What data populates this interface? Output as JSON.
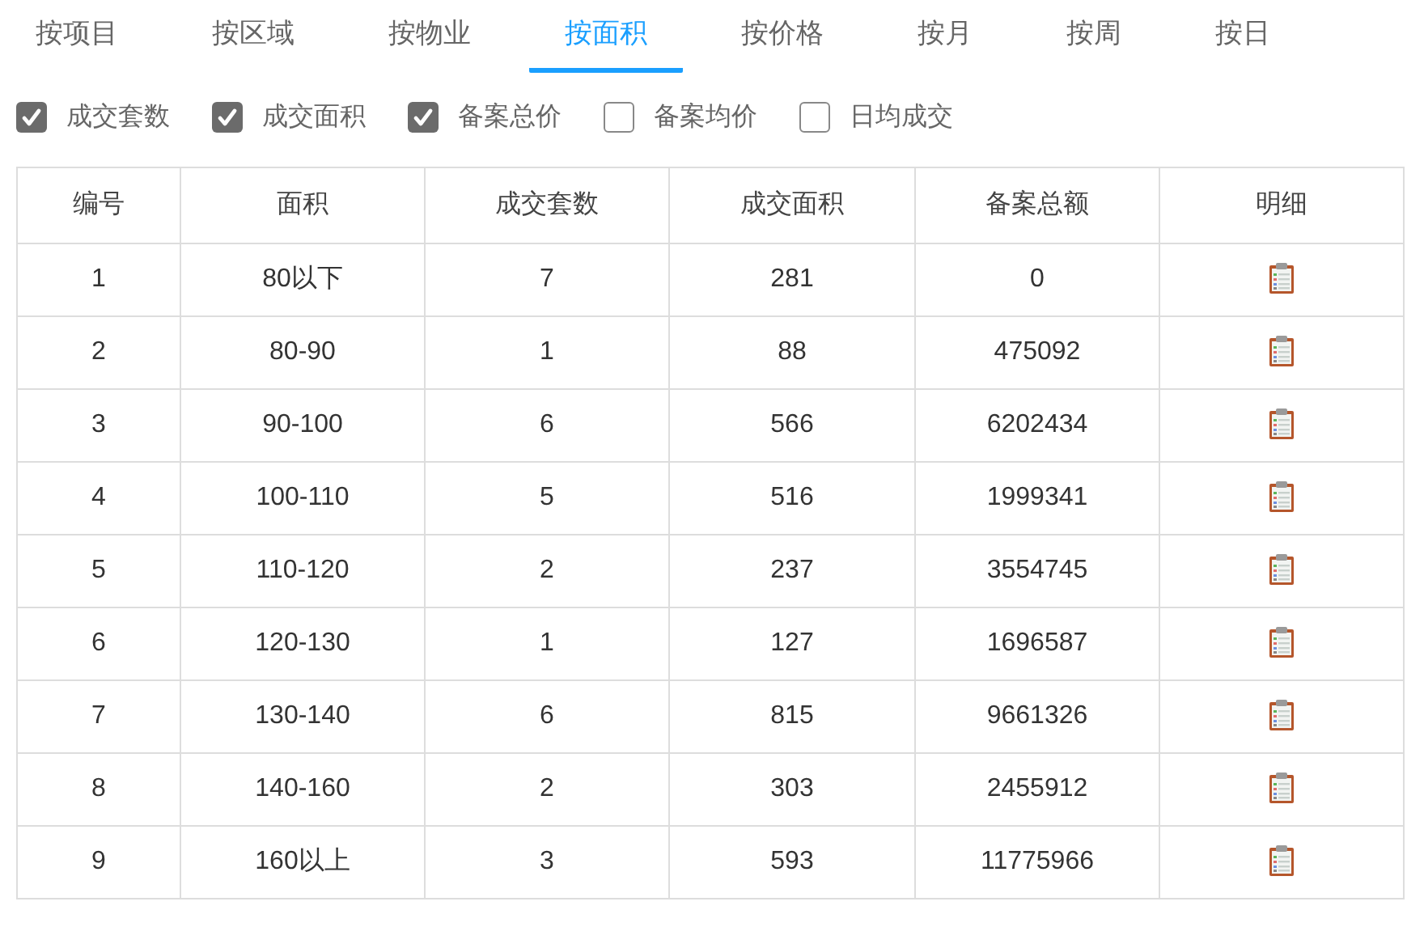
{
  "tabs": [
    {
      "label": "按项目",
      "selected": false
    },
    {
      "label": "按区域",
      "selected": false
    },
    {
      "label": "按物业",
      "selected": false
    },
    {
      "label": "按面积",
      "selected": true
    },
    {
      "label": "按价格",
      "selected": false
    },
    {
      "label": "按月",
      "selected": false
    },
    {
      "label": "按周",
      "selected": false
    },
    {
      "label": "按日",
      "selected": false
    }
  ],
  "options": [
    {
      "label": "成交套数",
      "checked": true
    },
    {
      "label": "成交面积",
      "checked": true
    },
    {
      "label": "备案总价",
      "checked": true
    },
    {
      "label": "备案均价",
      "checked": false
    },
    {
      "label": "日均成交",
      "checked": false
    }
  ],
  "table": {
    "columns": [
      "编号",
      "面积",
      "成交套数",
      "成交面积",
      "备案总额",
      "明细"
    ],
    "rows": [
      [
        "1",
        "80以下",
        "7",
        "281",
        "0"
      ],
      [
        "2",
        "80-90",
        "1",
        "88",
        "475092"
      ],
      [
        "3",
        "90-100",
        "6",
        "566",
        "6202434"
      ],
      [
        "4",
        "100-110",
        "5",
        "516",
        "1999341"
      ],
      [
        "5",
        "110-120",
        "2",
        "237",
        "3554745"
      ],
      [
        "6",
        "120-130",
        "1",
        "127",
        "1696587"
      ],
      [
        "7",
        "130-140",
        "6",
        "815",
        "9661326"
      ],
      [
        "8",
        "140-160",
        "2",
        "303",
        "2455912"
      ],
      [
        "9",
        "160以上",
        "3",
        "593",
        "11775966"
      ]
    ]
  }
}
